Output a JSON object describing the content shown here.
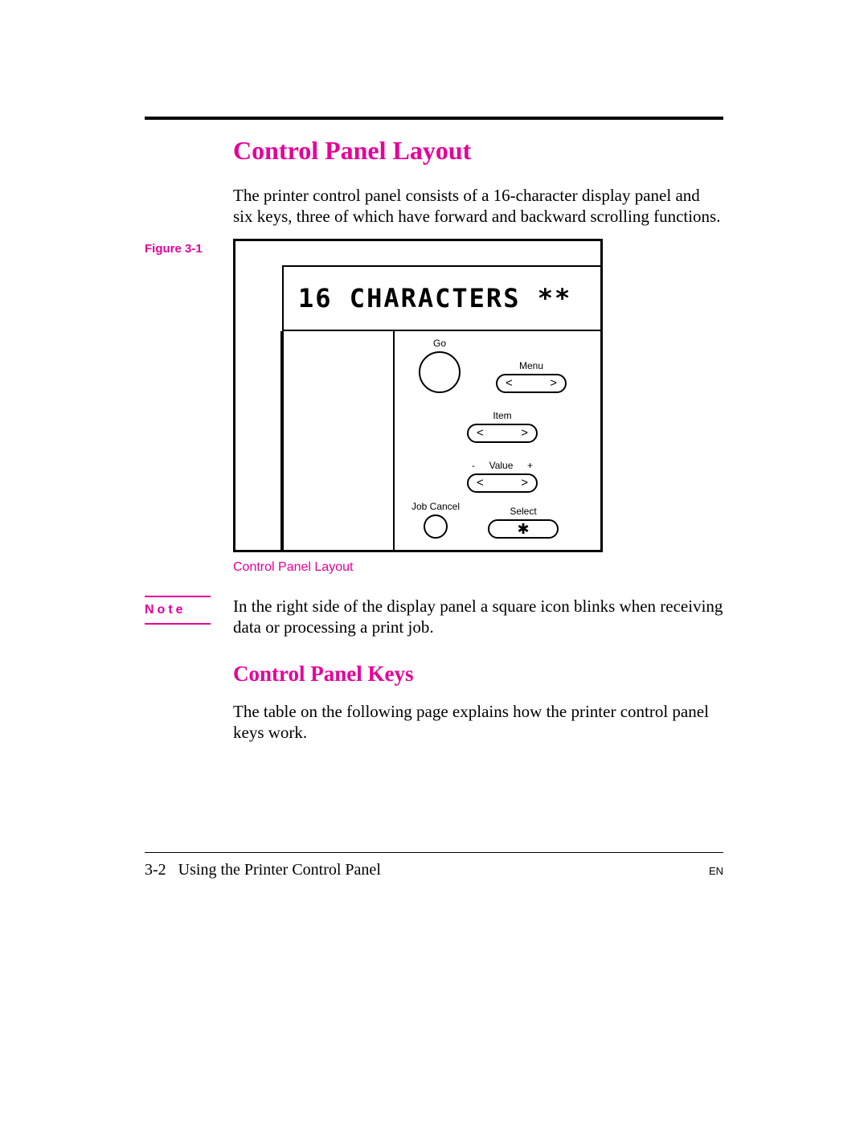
{
  "heading1": "Control Panel Layout",
  "intro": "The printer control panel consists of a 16-character display panel and six keys, three of which have forward and backward scrolling functions.",
  "figure": {
    "label": "Figure 3-1",
    "display_text": "16 CHARACTERS **",
    "caption": "Control Panel Layout",
    "buttons": {
      "go": "Go",
      "menu": "Menu",
      "item": "Item",
      "value_minus": "-",
      "value_label": "Value",
      "value_plus": "+",
      "job_cancel": "Job Cancel",
      "select": "Select",
      "arrow_left": "<",
      "arrow_right": ">",
      "star": "✱"
    }
  },
  "note": {
    "label": "Note",
    "text": "In the right side of the display panel a square icon blinks when receiving data or processing a print job."
  },
  "heading2": "Control Panel Keys",
  "keys_text": "The table on the following page explains how the printer control panel keys work.",
  "footer": {
    "page": "3-2",
    "title": "Using the Printer Control Panel",
    "lang": "EN"
  }
}
